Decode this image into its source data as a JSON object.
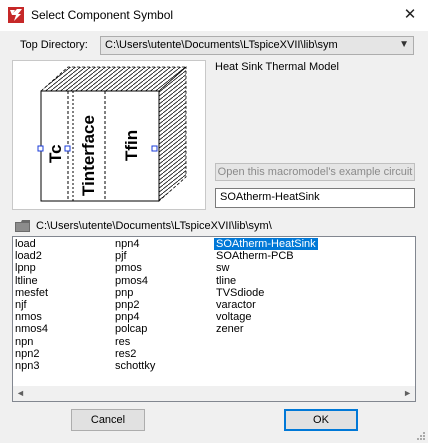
{
  "window": {
    "title": "Select Component Symbol",
    "close_glyph": "✕",
    "icon": "ltspice-app-icon"
  },
  "top_directory": {
    "label": "Top Directory:",
    "value": "C:\\Users\\utente\\Documents\\LTspiceXVII\\lib\\sym",
    "arrow": "▼"
  },
  "preview": {
    "labels": {
      "tc": "Tc",
      "tinterface": "Tinterface",
      "tfin": "Tfin"
    },
    "description": "Heat Sink Thermal Model"
  },
  "open_example_button": "Open this macromodel's example circuit",
  "symbol_name": "SOAtherm-HeatSink",
  "current_path": "C:\\Users\\utente\\Documents\\LTspiceXVII\\lib\\sym\\",
  "list": {
    "columns": [
      [
        "load",
        "load2",
        "lpnp",
        "ltline",
        "mesfet",
        "njf",
        "nmos",
        "nmos4",
        "npn",
        "npn2",
        "npn3"
      ],
      [
        "npn4",
        "pjf",
        "pmos",
        "pmos4",
        "pnp",
        "pnp2",
        "pnp4",
        "polcap",
        "res",
        "res2",
        "schottky"
      ],
      [
        "SOAtherm-HeatSink",
        "SOAtherm-PCB",
        "sw",
        "tline",
        "TVSdiode",
        "varactor",
        "voltage",
        "zener"
      ]
    ],
    "selected": "SOAtherm-HeatSink",
    "scroll_left": "◄",
    "scroll_right": "►"
  },
  "buttons": {
    "cancel": "Cancel",
    "ok": "OK"
  },
  "colors": {
    "selection": "#0078d7",
    "ok_border": "#0078d7"
  }
}
